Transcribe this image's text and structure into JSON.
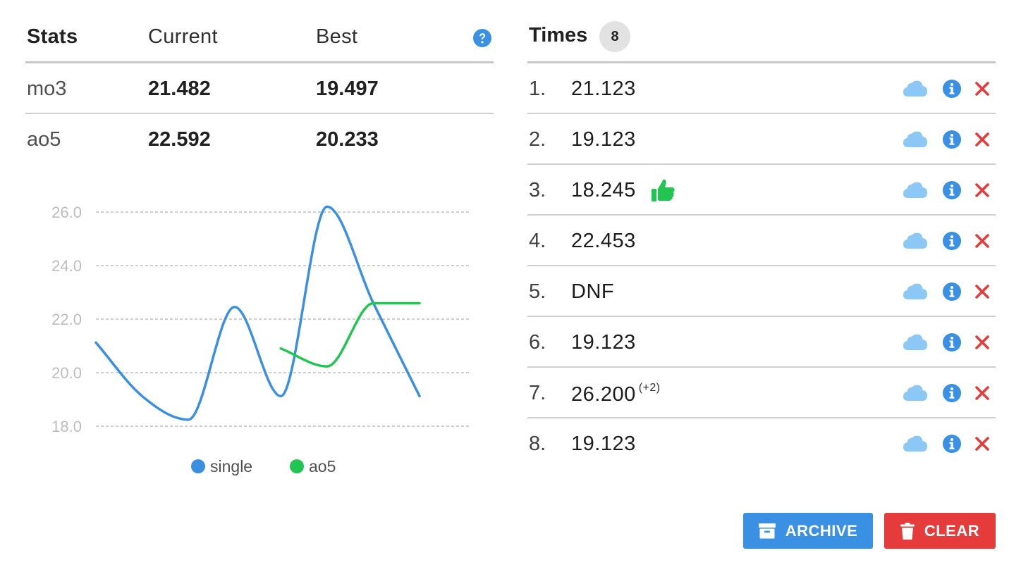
{
  "stats": {
    "headers": {
      "label": "Stats",
      "current": "Current",
      "best": "Best"
    },
    "help_icon": "question-circle-icon",
    "rows": [
      {
        "label": "mo3",
        "current": "21.482",
        "best": "19.497"
      },
      {
        "label": "ao5",
        "current": "22.592",
        "best": "20.233"
      }
    ]
  },
  "chart_data": {
    "type": "line",
    "x": [
      1,
      2,
      3,
      4,
      5,
      6,
      7,
      8
    ],
    "series": [
      {
        "name": "single",
        "color": "#3a8fe0",
        "values": [
          21.123,
          19.123,
          18.245,
          22.453,
          19.123,
          26.2,
          22.6,
          19.123
        ]
      },
      {
        "name": "ao5",
        "color": "#23c552",
        "values": [
          null,
          null,
          null,
          null,
          20.9,
          20.233,
          22.592,
          22.592
        ]
      }
    ],
    "y_ticks": [
      "18.0",
      "20.0",
      "22.0",
      "24.0",
      "26.0"
    ],
    "ylim": [
      18,
      26
    ],
    "grid": true,
    "legend_position": "bottom"
  },
  "times": {
    "title": "Times",
    "count": "8",
    "entries": [
      {
        "index": "1.",
        "value": "21.123",
        "penalty": "",
        "best": false
      },
      {
        "index": "2.",
        "value": "19.123",
        "penalty": "",
        "best": false
      },
      {
        "index": "3.",
        "value": "18.245",
        "penalty": "",
        "best": true
      },
      {
        "index": "4.",
        "value": "22.453",
        "penalty": "",
        "best": false
      },
      {
        "index": "5.",
        "value": "DNF",
        "penalty": "",
        "best": false
      },
      {
        "index": "6.",
        "value": "19.123",
        "penalty": "",
        "best": false
      },
      {
        "index": "7.",
        "value": "26.200",
        "penalty": "(+2)",
        "best": false
      },
      {
        "index": "8.",
        "value": "19.123",
        "penalty": "",
        "best": false
      }
    ],
    "row_icons": [
      "cloud-icon",
      "info-icon",
      "delete-icon"
    ],
    "best_icon": "thumbs-up-icon"
  },
  "actions": {
    "archive_label": "ARCHIVE",
    "clear_label": "CLEAR"
  },
  "colors": {
    "blue": "#3a90e2",
    "green": "#23c552",
    "red": "#e53b3b",
    "cloud": "#8cc8f5"
  }
}
